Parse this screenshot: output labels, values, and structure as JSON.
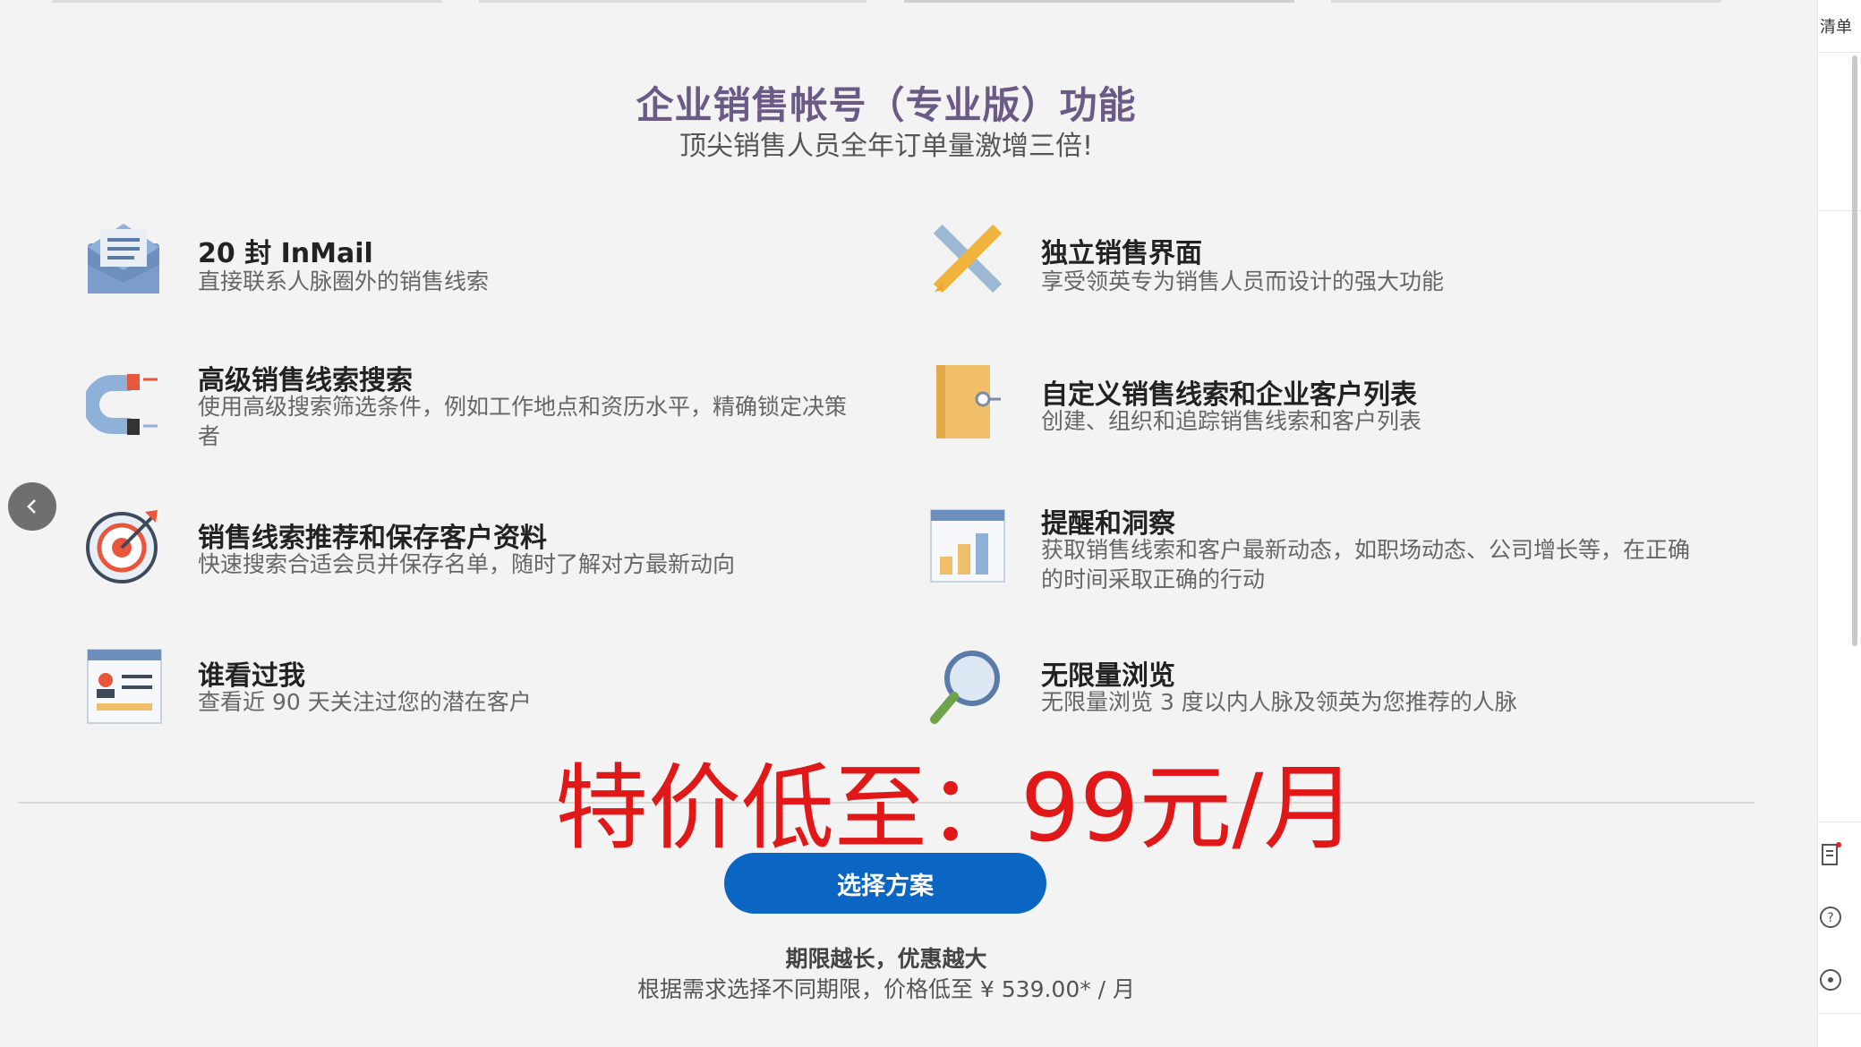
{
  "header": {
    "title": "企业销售帐号（专业版）功能",
    "subtitle": "顶尖销售人员全年订单量激增三倍!"
  },
  "features": [
    {
      "icon": "envelope-icon",
      "title": "20 封 InMail",
      "desc": "直接联系人脉圈外的销售线索"
    },
    {
      "icon": "pencil-ruler-icon",
      "title": "独立销售界面",
      "desc": "享受领英专为销售人员而设计的强大功能"
    },
    {
      "icon": "magnet-icon",
      "title": "高级销售线索搜索",
      "desc": "使用高级搜索筛选条件，例如工作地点和资历水平，精确锁定决策者"
    },
    {
      "icon": "notebook-icon",
      "title": "自定义销售线索和企业客户列表",
      "desc": "创建、组织和追踪销售线索和客户列表"
    },
    {
      "icon": "target-icon",
      "title": "销售线索推荐和保存客户资料",
      "desc": "快速搜索合适会员并保存名单，随时了解对方最新动向"
    },
    {
      "icon": "bar-chart-icon",
      "title": "提醒和洞察",
      "desc": "获取销售线索和客户最新动态，如职场动态、公司增长等，在正确的时间采取正确的行动"
    },
    {
      "icon": "profile-card-icon",
      "title": "谁看过我",
      "desc": "查看近 90 天关注过您的潜在客户"
    },
    {
      "icon": "magnifier-icon",
      "title": "无限量浏览",
      "desc": "无限量浏览 3 度以内人脉及领英为您推荐的人脉"
    }
  ],
  "promo": {
    "text": "特价低至：99元/月",
    "color": "#e01818"
  },
  "cta": {
    "label": "选择方案",
    "color": "#0a66c2"
  },
  "terms": {
    "headline": "期限越长，优惠越大",
    "detail": "根据需求选择不同期限，价格低至 ¥ 539.00* / 月"
  },
  "side_panel": {
    "list_label": "清单"
  }
}
